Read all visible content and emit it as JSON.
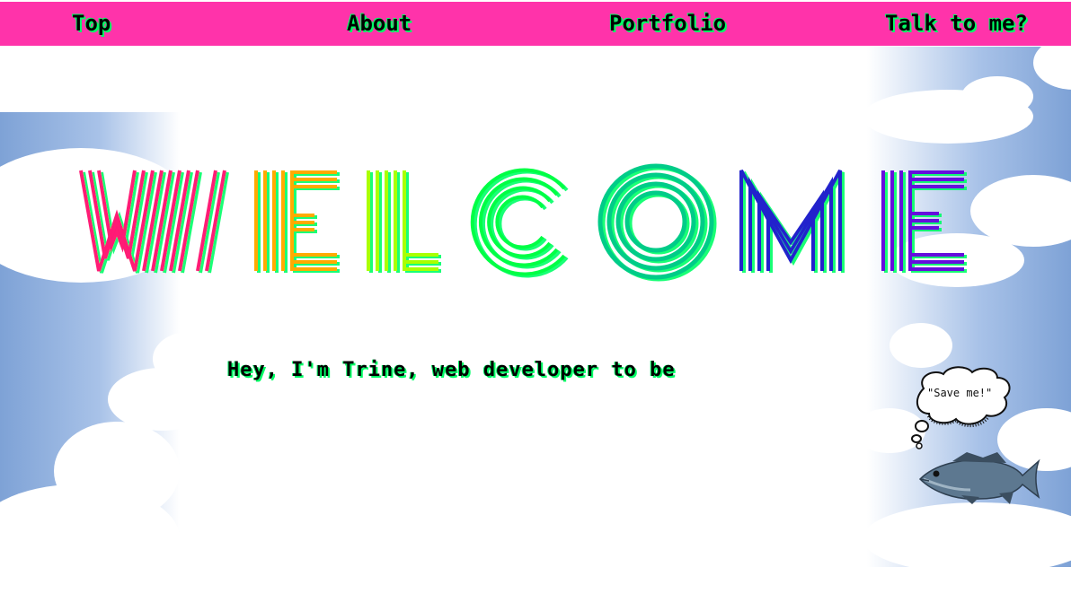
{
  "nav": {
    "items": [
      {
        "label": "Top"
      },
      {
        "label": "About"
      },
      {
        "label": "Portfolio"
      },
      {
        "label": "Talk to me?"
      }
    ],
    "background": "#ff33aa"
  },
  "hero": {
    "letters": [
      "W",
      "E",
      "L",
      "C",
      "O",
      "M",
      "E"
    ],
    "tagline": "Hey, I'm Trine, web developer to be"
  },
  "mascot": {
    "thought": "\"Save me!\"",
    "icon": "fish-icon"
  },
  "colors": {
    "pink": "#ff1a75",
    "orange": "#ffaa00",
    "lime": "#aaff00",
    "green": "#00ff44",
    "teal": "#00cc88",
    "blue": "#2222cc",
    "purple": "#6611dd",
    "glow": "#00ff66",
    "sky": "#7ea2d6"
  }
}
